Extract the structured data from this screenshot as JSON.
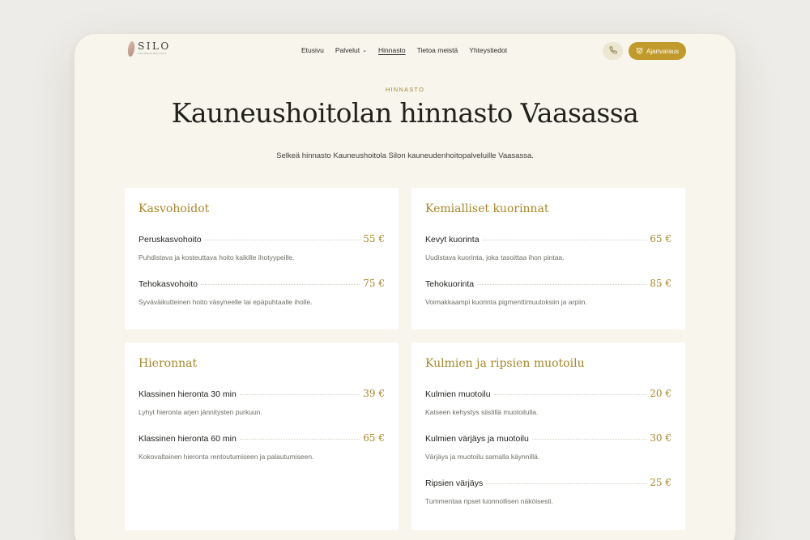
{
  "brand": {
    "name": "SILO",
    "tagline": "KAUNEUSHOITOLA"
  },
  "nav": {
    "items": [
      {
        "label": "Etusivu"
      },
      {
        "label": "Palvelut"
      },
      {
        "label": "Hinnasto"
      },
      {
        "label": "Tietoa meistä"
      },
      {
        "label": "Yhteystiedot"
      }
    ],
    "dropdown_icon": "chevron-down-icon",
    "active": "Hinnasto",
    "booking_label": "Ajanvaraus",
    "phone_icon": "phone-icon"
  },
  "hero": {
    "eyebrow": "HINNASTO",
    "title": "Kauneushoitolan hinnasto Vaasassa",
    "intro": "Selkeä hinnasto Kauneushoitola Silon kauneudenhoitopalveluille Vaasassa."
  },
  "colors": {
    "accent": "#c19a2c",
    "background": "#f7f5ec",
    "card": "#ffffff"
  },
  "categories": [
    {
      "title": "Kasvohoidot",
      "items": [
        {
          "name": "Peruskasvohoito",
          "price": "55 €",
          "desc": "Puhdistava ja kosteuttava hoito kaikille ihotyypeille."
        },
        {
          "name": "Tehokasvohoito",
          "price": "75 €",
          "desc": "Syväväikutteinen hoito väsyneelle tai epäpuhtaalle iholle."
        }
      ]
    },
    {
      "title": "Kemialliset kuorinnat",
      "items": [
        {
          "name": "Kevyt kuorinta",
          "price": "65 €",
          "desc": "Uudistava kuorinta, joka tasoittaa ihon pintaa."
        },
        {
          "name": "Tehokuorinta",
          "price": "85 €",
          "desc": "Voimakkaampi kuorinta pigmenttimuutoksiin ja arpiin."
        }
      ]
    },
    {
      "title": "Hieronnat",
      "items": [
        {
          "name": "Klassinen hieronta 30 min",
          "price": "39 €",
          "desc": "Lyhyt hieronta arjen jännitysten purkuun."
        },
        {
          "name": "Klassinen hieronta 60 min",
          "price": "65 €",
          "desc": "Kokovaltainen hieronta rentoutumiseen ja palautumiseen."
        }
      ]
    },
    {
      "title": "Kulmien ja ripsien muotoilu",
      "items": [
        {
          "name": "Kulmien muotoilu",
          "price": "20 €",
          "desc": "Katseen kehystys siistillä muotoilulla."
        },
        {
          "name": "Kulmien värjäys ja muotoilu",
          "price": "30 €",
          "desc": "Värjäys ja muotoilu samalla käynnillä."
        },
        {
          "name": "Ripsien värjäys",
          "price": "25 €",
          "desc": "Tummentaa ripset luonnollisen näköisesti."
        }
      ]
    }
  ]
}
